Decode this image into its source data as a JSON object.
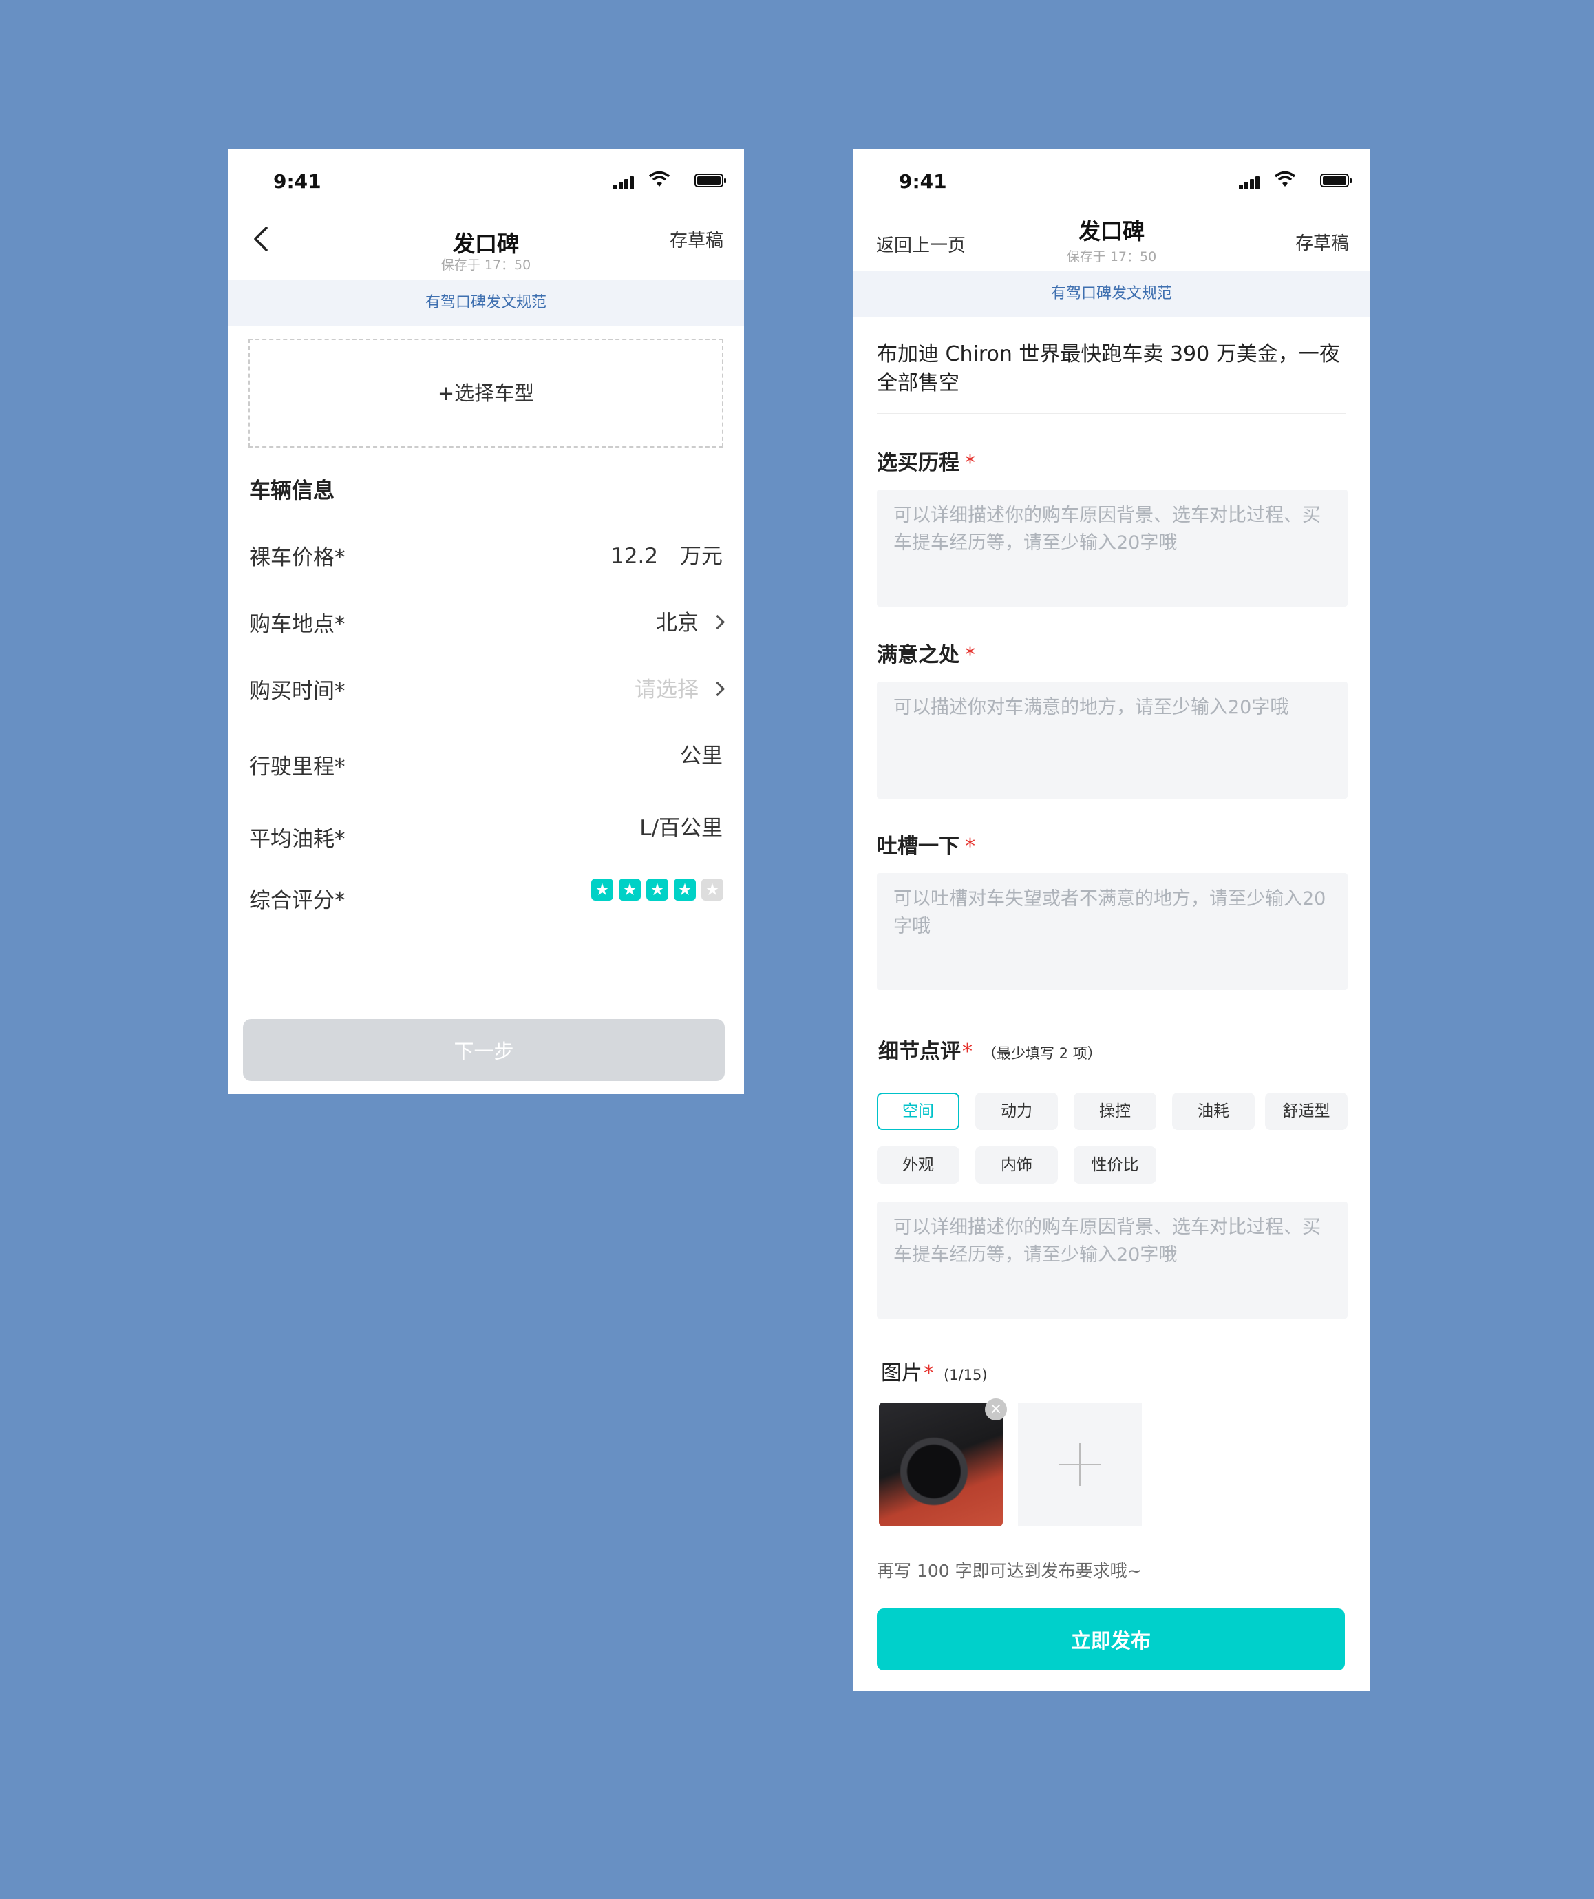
{
  "phone1": {
    "status": {
      "time": "9:41"
    },
    "nav": {
      "title": "发口碑",
      "saved": "保存于 17：50",
      "draft": "存草稿"
    },
    "notice": "有驾口碑发文规范",
    "select_model": "+选择车型",
    "section_title": "车辆信息",
    "fields": [
      {
        "label": "裸车价格*",
        "value": "12.2",
        "unit": "万元"
      },
      {
        "label": "购车地点*",
        "value": "北京"
      },
      {
        "label": "购买时间*",
        "placeholder": "请选择"
      },
      {
        "label": "行驶里程*",
        "unit": "公里"
      },
      {
        "label": "平均油耗*",
        "unit": "L/百公里"
      },
      {
        "label": "综合评分*",
        "rating": 4,
        "rating_max": 5
      }
    ],
    "next_button": "下一步"
  },
  "phone2": {
    "status": {
      "time": "9:41"
    },
    "nav": {
      "back": "返回上一页",
      "title": "发口碑",
      "saved": "保存于 17：50",
      "draft": "存草稿"
    },
    "notice": "有驾口碑发文规范",
    "article_title": "布加迪 Chiron 世界最快跑车卖 390 万美金，一夜全部售空",
    "sections": [
      {
        "label": "选买历程",
        "required": "*",
        "placeholder": "可以详细描述你的购车原因背景、选车对比过程、买车提车经历等，请至少输入20字哦"
      },
      {
        "label": "满意之处",
        "required": "*",
        "placeholder": "可以描述你对车满意的地方，请至少输入20字哦"
      },
      {
        "label": "吐槽一下",
        "required": "*",
        "placeholder": "可以吐槽对车失望或者不满意的地方，请至少输入20字哦"
      }
    ],
    "detail": {
      "label": "细节点评",
      "required": "*",
      "hint": "（最少填写 2 项）",
      "tags": [
        "空间",
        "动力",
        "操控",
        "油耗",
        "舒适型",
        "外观",
        "内饰",
        "性价比"
      ],
      "active_tag": "空间",
      "placeholder": "可以详细描述你的购车原因背景、选车对比过程、买车提车经历等，请至少输入20字哦"
    },
    "photos": {
      "label": "图片",
      "required": "*",
      "count": "(1/15)",
      "remove_glyph": "×"
    },
    "progress_hint": "再写 100 字即可达到发布要求哦~",
    "publish_button": "立即发布"
  },
  "colors": {
    "background": "#6890C3",
    "accent": "#00D0CB",
    "required": "#E5322D",
    "notice_text": "#3E6FB0"
  },
  "icons": [
    "signal-icon",
    "wifi-icon",
    "battery-icon",
    "back-arrow-icon",
    "chevron-right-icon",
    "star-icon",
    "close-icon",
    "plus-icon"
  ]
}
